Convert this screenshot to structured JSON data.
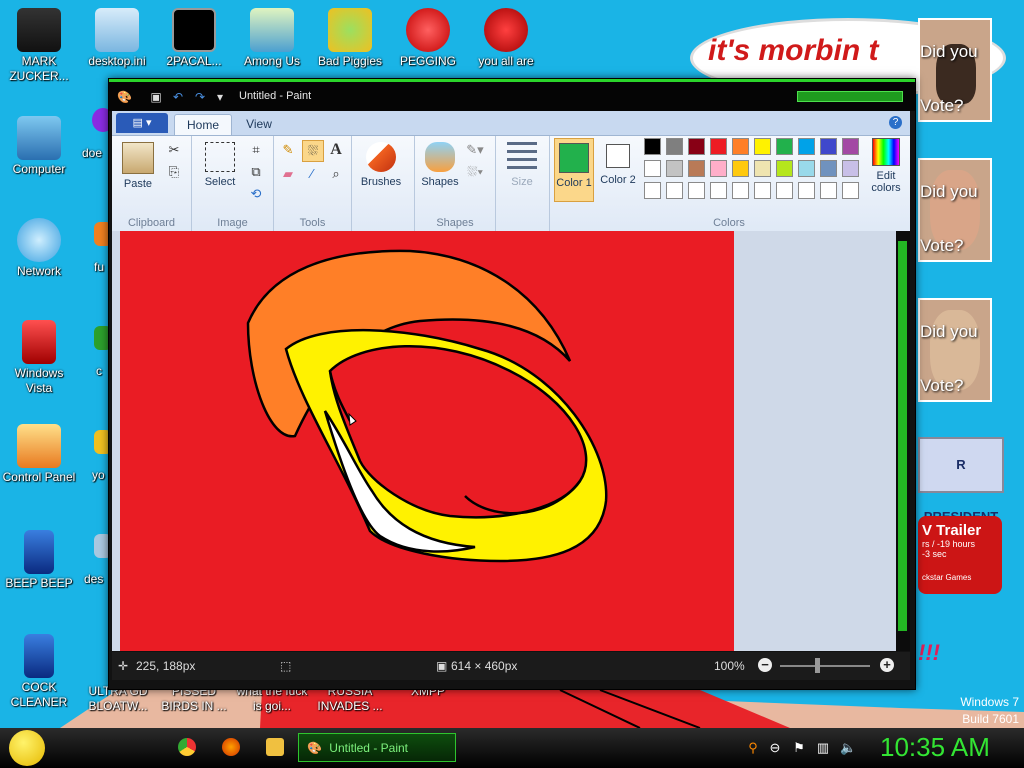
{
  "desktop": {
    "icons_col1": [
      {
        "label": "MARK ZUCKER...",
        "icon": "person-icon"
      },
      {
        "label": "Computer",
        "icon": "computer-icon"
      },
      {
        "label": "Network",
        "icon": "network-icon"
      },
      {
        "label": "Windows Vista",
        "icon": "recycle-bin-icon"
      },
      {
        "label": "Control Panel",
        "icon": "control-panel-icon"
      },
      {
        "label": "BEEP BEEP",
        "icon": "blue-app-icon"
      },
      {
        "label": "COCK CLEANER",
        "icon": "blue-app-icon"
      }
    ],
    "icons_row1": [
      {
        "label": "desktop.ini",
        "icon": "file-icon"
      },
      {
        "label": "2PACAL...",
        "icon": "console-icon"
      },
      {
        "label": "Among Us",
        "icon": "among-us-icon"
      },
      {
        "label": "Bad Piggies",
        "icon": "bad-piggies-icon"
      },
      {
        "label": "PEGGING",
        "icon": "p-app-icon"
      },
      {
        "label": "you all are",
        "icon": "devcpp-icon"
      }
    ],
    "partial_labels": [
      "doe",
      "fu",
      "c",
      "yo",
      "des"
    ],
    "bottom_labels": [
      "ULTRA GD BLOATW...",
      "PISSED BIRDS IN ...",
      "what the fuck is goi...",
      "RUSSIA INVADES ...",
      "XMPP"
    ],
    "bubble_text": "it's morbin t",
    "tiles": [
      {
        "caption_top": "Did you",
        "caption_bottom": "Vote?"
      },
      {
        "caption_top": "Did you",
        "caption_bottom": "Vote?"
      },
      {
        "caption_top": "Did you",
        "caption_bottom": "Vote?"
      }
    ],
    "banner": "R PRESIDENT",
    "gta": {
      "title": "V Trailer",
      "line1": "rs / -19 hours",
      "line2": "-3 sec",
      "line3": "ckstar Games"
    },
    "red_marks": "!!!",
    "watermark_line1": "Windows 7",
    "watermark_line2": "Build 7601"
  },
  "paint": {
    "title": "Untitled - Paint",
    "tabs": {
      "home": "Home",
      "view": "View"
    },
    "help": "?",
    "groups": {
      "clipboard": "Clipboard",
      "image": "Image",
      "tools": "Tools",
      "shapes": "Shapes",
      "colors": "Colors"
    },
    "buttons": {
      "paste": "Paste",
      "select": "Select",
      "brushes": "Brushes",
      "shapes": "Shapes",
      "size": "Size",
      "color1": "Color 1",
      "color2": "Color 2",
      "edit_colors": "Edit colors"
    },
    "tool_glyphs": {
      "text": "A"
    },
    "color1_hex": "#22b14c",
    "color2_hex": "#ffffff",
    "palette_row1": [
      "#000000",
      "#7f7f7f",
      "#880015",
      "#ed1c24",
      "#ff7f27",
      "#fff200",
      "#22b14c",
      "#00a2e8",
      "#3f48cc",
      "#a349a4"
    ],
    "palette_row2": [
      "#ffffff",
      "#c3c3c3",
      "#b97a57",
      "#ffaec9",
      "#ffc90e",
      "#efe4b0",
      "#b5e61d",
      "#99d9ea",
      "#7092be",
      "#c8bfe7"
    ],
    "palette_row3": [
      "#ffffff",
      "#ffffff",
      "#ffffff",
      "#ffffff",
      "#ffffff",
      "#ffffff",
      "#ffffff",
      "#ffffff",
      "#ffffff",
      "#ffffff"
    ],
    "status": {
      "cursor_pos": "225, 188px",
      "canvas_size": "614 × 460px",
      "zoom": "100%"
    }
  },
  "taskbar": {
    "task_label": "Untitled - Paint",
    "clock": "10:35 AM"
  }
}
